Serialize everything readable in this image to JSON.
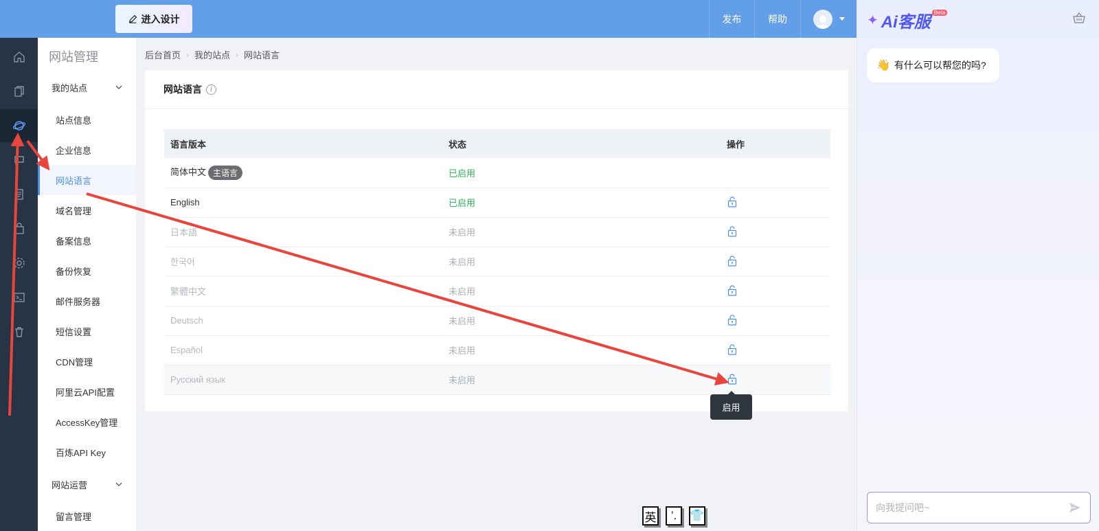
{
  "header": {
    "design_button": "进入设计",
    "publish": "发布",
    "help": "帮助"
  },
  "ai": {
    "logo_text": "Ai客服",
    "beta": "Beta",
    "greeting": "有什么可以帮您的吗?",
    "input_placeholder": "向我提问吧~"
  },
  "rail": {
    "items": [
      "home-icon",
      "pages-icon",
      "site-globe-icon",
      "chat-icon",
      "document-icon",
      "shopping-bag-icon",
      "settings-gear-icon",
      "terminal-icon",
      "trash-icon"
    ],
    "active_index": 2
  },
  "subnav": {
    "title": "网站管理",
    "group1": "我的站点",
    "items": [
      "站点信息",
      "企业信息",
      "网站语言",
      "域名管理",
      "备案信息",
      "备份恢复",
      "邮件服务器",
      "短信设置",
      "CDN管理",
      "阿里云API配置",
      "AccessKey管理",
      "百炼API Key"
    ],
    "active": "网站语言",
    "group2": "网站运营",
    "group2_items": [
      "留言管理"
    ]
  },
  "breadcrumb": [
    "后台首页",
    "我的站点",
    "网站语言"
  ],
  "card": {
    "title": "网站语言",
    "info_glyph": "i"
  },
  "table": {
    "headers": [
      "语言版本",
      "状态",
      "操作"
    ],
    "rows": [
      {
        "lang": "简体中文",
        "badge": "主语言",
        "status": "已启用",
        "enabled": true,
        "lock": false
      },
      {
        "lang": "English",
        "status": "已启用",
        "enabled": true,
        "lock": true
      },
      {
        "lang": "日本語",
        "status": "未启用",
        "enabled": false,
        "lock": true
      },
      {
        "lang": "한국어",
        "status": "未启用",
        "enabled": false,
        "lock": true
      },
      {
        "lang": "繁體中文",
        "status": "未启用",
        "enabled": false,
        "lock": true
      },
      {
        "lang": "Deutsch",
        "status": "未启用",
        "enabled": false,
        "lock": true
      },
      {
        "lang": "Español",
        "status": "未启用",
        "enabled": false,
        "lock": true
      },
      {
        "lang": "Русский язык",
        "status": "未启用",
        "enabled": false,
        "lock": true
      }
    ]
  },
  "tooltip": "启用",
  "ime": [
    "英",
    "’.",
    "👕"
  ],
  "colors": {
    "header": "#639fe9",
    "rail": "#263445",
    "accent": "#4a90e2",
    "enabled": "#2fb45a",
    "annotation_arrow": "#e8453c"
  }
}
